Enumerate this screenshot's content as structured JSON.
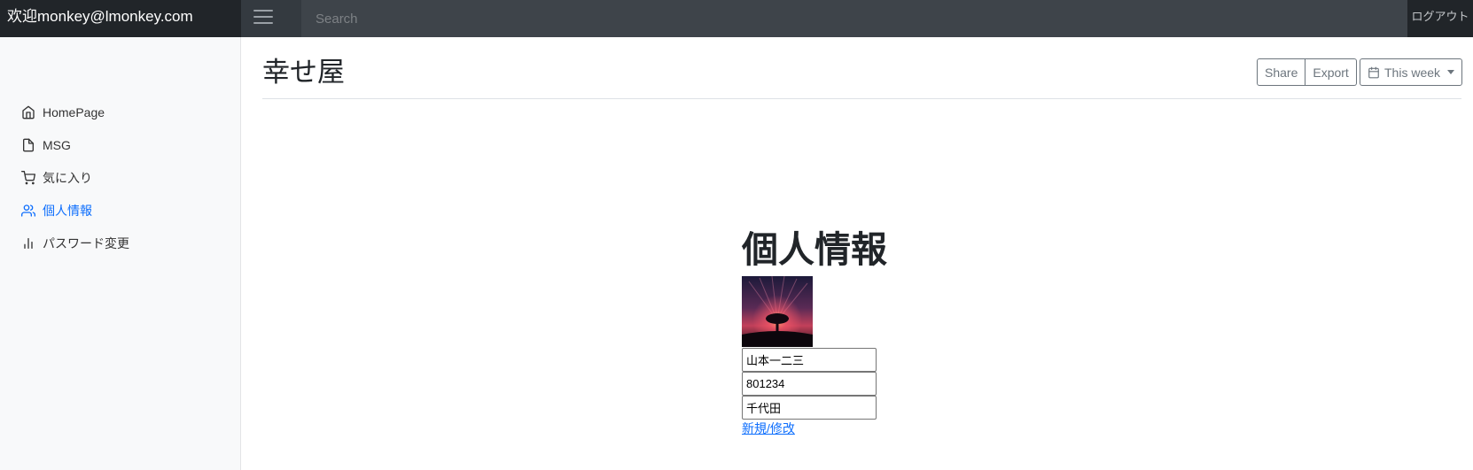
{
  "navbar": {
    "brand": "欢迎monkey@lmonkey.com",
    "search_placeholder": "Search",
    "logout": "ログアウト"
  },
  "sidebar": {
    "items": [
      {
        "label": "HomePage",
        "icon": "home-icon",
        "active": false
      },
      {
        "label": "MSG",
        "icon": "file-icon",
        "active": false
      },
      {
        "label": "気に入り",
        "icon": "cart-icon",
        "active": false
      },
      {
        "label": "個人情報",
        "icon": "users-icon",
        "active": true
      },
      {
        "label": "パスワード変更",
        "icon": "bar-chart-icon",
        "active": false
      }
    ]
  },
  "header": {
    "title": "幸せ屋",
    "share": "Share",
    "export": "Export",
    "period": "This week"
  },
  "profile": {
    "heading": "個人情報",
    "name": "山本一二三",
    "postal_code": "801234",
    "address": "千代田",
    "submit_link": "新規/修改"
  },
  "colors": {
    "navbar_bg": "#343a40",
    "brand_bg": "#212529",
    "active_link": "#0d6efd",
    "sidebar_bg": "#f8f9fa"
  }
}
